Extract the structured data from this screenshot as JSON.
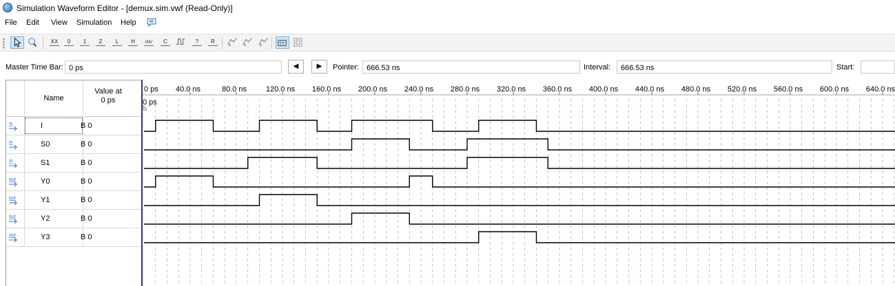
{
  "window": {
    "title": "Simulation Waveform Editor - [demux.sim.vwf (Read-Only)]"
  },
  "menu": [
    "File",
    "Edit",
    "View",
    "Simulation",
    "Help"
  ],
  "toolbar": {
    "tools": [
      {
        "name": "selection-tool",
        "label": ""
      },
      {
        "name": "zoom-tool",
        "label": ""
      },
      {
        "name": "forcing-unknown",
        "label": "XX"
      },
      {
        "name": "forcing-low",
        "label": "0"
      },
      {
        "name": "forcing-high",
        "label": "1"
      },
      {
        "name": "high-impedance",
        "label": "Z"
      },
      {
        "name": "weak-low",
        "label": "L"
      },
      {
        "name": "weak-high",
        "label": "H"
      },
      {
        "name": "invert",
        "label": "INV"
      },
      {
        "name": "count-value",
        "label": "C"
      },
      {
        "name": "clock",
        "label": ""
      },
      {
        "name": "arbitrary-value",
        "label": "?"
      },
      {
        "name": "random-value",
        "label": "R"
      },
      {
        "name": "functional-sim",
        "label": ""
      },
      {
        "name": "timing-sim",
        "label": ""
      },
      {
        "name": "netlist-viewer",
        "label": ""
      },
      {
        "name": "snap-to-grid",
        "label": ""
      },
      {
        "name": "grid-settings",
        "label": ""
      }
    ]
  },
  "timebar": {
    "master_label": "Master Time Bar:",
    "master_value": "0 ps",
    "pointer_label": "Pointer:",
    "pointer_value": "666.53 ns",
    "interval_label": "Interval:",
    "interval_value": "666.53 ns",
    "start_label": "Start:",
    "start_value": ""
  },
  "columns": {
    "name": "Name",
    "value_line1": "Value at",
    "value_line2": "0 ps"
  },
  "ruler": {
    "ticks": [
      "0 ps",
      "40.0 ns",
      "80.0 ns",
      "120.0 ns",
      "160.0 ns",
      "200.0 ns",
      "240.0 ns",
      "280.0 ns",
      "320.0 ns",
      "360.0 ns",
      "400.0 ns",
      "440.0 ns",
      "480.0 ns",
      "520.0 ns",
      "560.0 ns",
      "600.0 ns",
      "640.0 ns"
    ],
    "cursor_label": "0 ps"
  },
  "signals": [
    {
      "dir": "in",
      "name": "I",
      "value": "B 0",
      "transitions_ns": [
        10,
        60,
        100,
        150,
        180,
        250,
        290,
        340
      ]
    },
    {
      "dir": "in",
      "name": "S0",
      "value": "B 0",
      "transitions_ns": [
        180,
        230,
        280,
        350
      ]
    },
    {
      "dir": "in",
      "name": "S1",
      "value": "B 0",
      "transitions_ns": [
        90,
        150,
        280,
        350
      ]
    },
    {
      "dir": "out",
      "name": "Y0",
      "value": "B 0",
      "transitions_ns": [
        10,
        60,
        230,
        250
      ]
    },
    {
      "dir": "out",
      "name": "Y1",
      "value": "B 0",
      "transitions_ns": [
        100,
        150
      ]
    },
    {
      "dir": "out",
      "name": "Y2",
      "value": "B 0",
      "transitions_ns": [
        180,
        230
      ]
    },
    {
      "dir": "out",
      "name": "Y3",
      "value": "B 0",
      "transitions_ns": [
        290,
        340
      ]
    }
  ],
  "colors": {
    "cursor": "#2f2f9a",
    "grid": "#9a9a9a",
    "wave": "#000000",
    "in_icon": "#2f6fd1",
    "out_icon": "#2f6fd1"
  }
}
